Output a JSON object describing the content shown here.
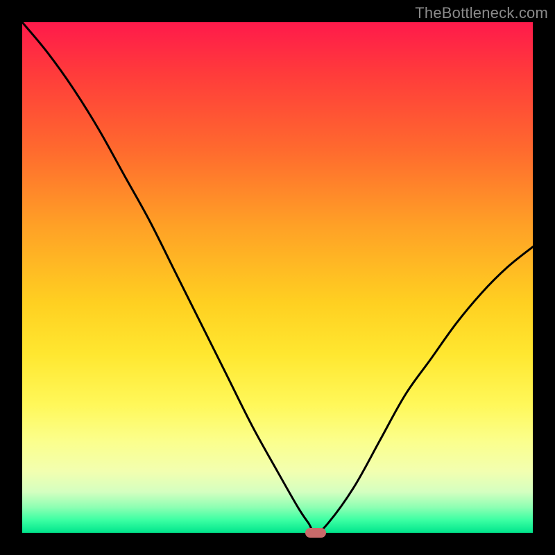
{
  "watermark": "TheBottleneck.com",
  "colors": {
    "frame": "#000000",
    "marker": "#c96a6a",
    "curve": "#000000"
  },
  "chart_data": {
    "type": "line",
    "title": "",
    "xlabel": "",
    "ylabel": "",
    "xlim": [
      0,
      1
    ],
    "ylim": [
      0,
      1
    ],
    "grid": false,
    "legend": false,
    "series": [
      {
        "name": "bottleneck-curve",
        "x": [
          0.0,
          0.05,
          0.1,
          0.15,
          0.2,
          0.25,
          0.3,
          0.35,
          0.4,
          0.45,
          0.5,
          0.54,
          0.56,
          0.575,
          0.6,
          0.65,
          0.7,
          0.75,
          0.8,
          0.85,
          0.9,
          0.95,
          1.0
        ],
        "y": [
          1.0,
          0.94,
          0.87,
          0.79,
          0.7,
          0.61,
          0.51,
          0.41,
          0.31,
          0.21,
          0.12,
          0.05,
          0.02,
          0.0,
          0.02,
          0.09,
          0.18,
          0.27,
          0.34,
          0.41,
          0.47,
          0.52,
          0.56
        ]
      }
    ],
    "marker": {
      "x": 0.575,
      "y": 0.0
    }
  }
}
